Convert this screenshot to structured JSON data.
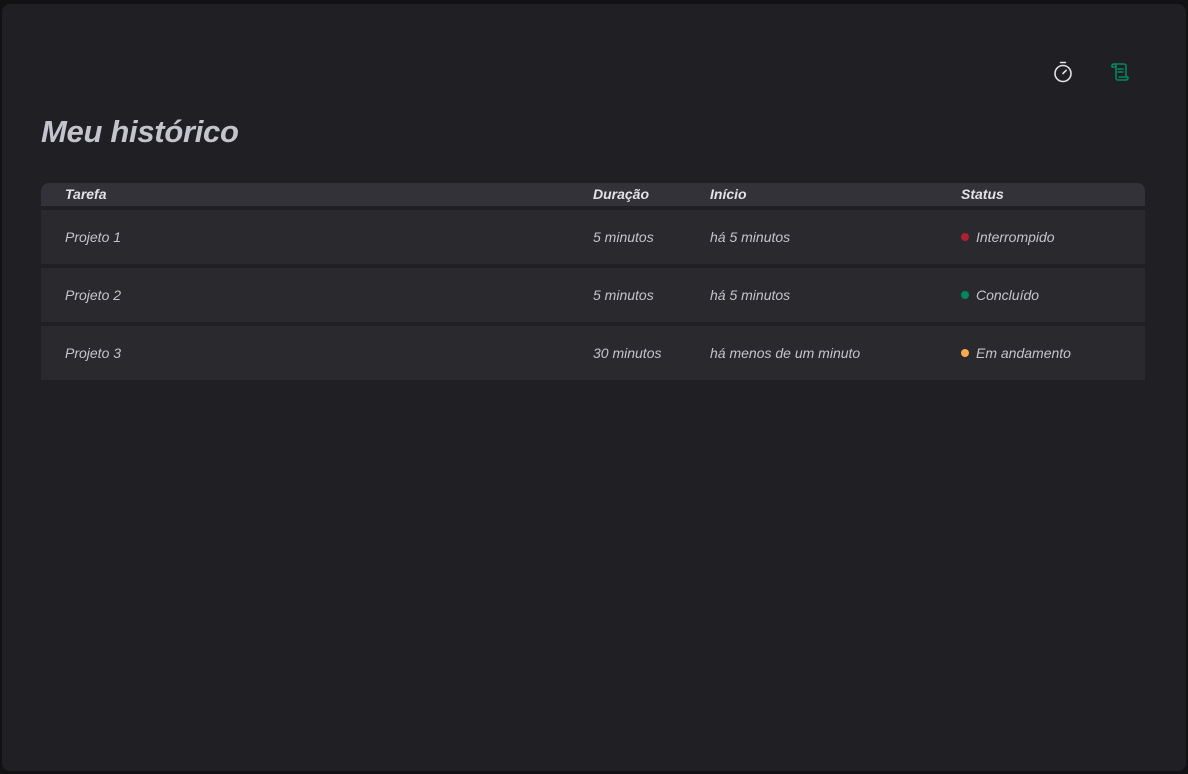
{
  "nav": {
    "timer_icon": "timer-icon",
    "history_icon": "scroll-icon",
    "active_color": "#00875f",
    "inactive_color": "#e1e1e6"
  },
  "page": {
    "title": "Meu histórico"
  },
  "table": {
    "headers": {
      "task": "Tarefa",
      "duration": "Duração",
      "start": "Início",
      "status": "Status"
    },
    "rows": [
      {
        "task": "Projeto 1",
        "duration": "5 minutos",
        "start": "há 5 minutos",
        "status": "Interrompido",
        "status_color": "#ab222e"
      },
      {
        "task": "Projeto 2",
        "duration": "5 minutos",
        "start": "há 5 minutos",
        "status": "Concluído",
        "status_color": "#00875f"
      },
      {
        "task": "Projeto 3",
        "duration": "30 minutos",
        "start": "há menos de um minuto",
        "status": "Em andamento",
        "status_color": "#fba94c"
      }
    ]
  }
}
